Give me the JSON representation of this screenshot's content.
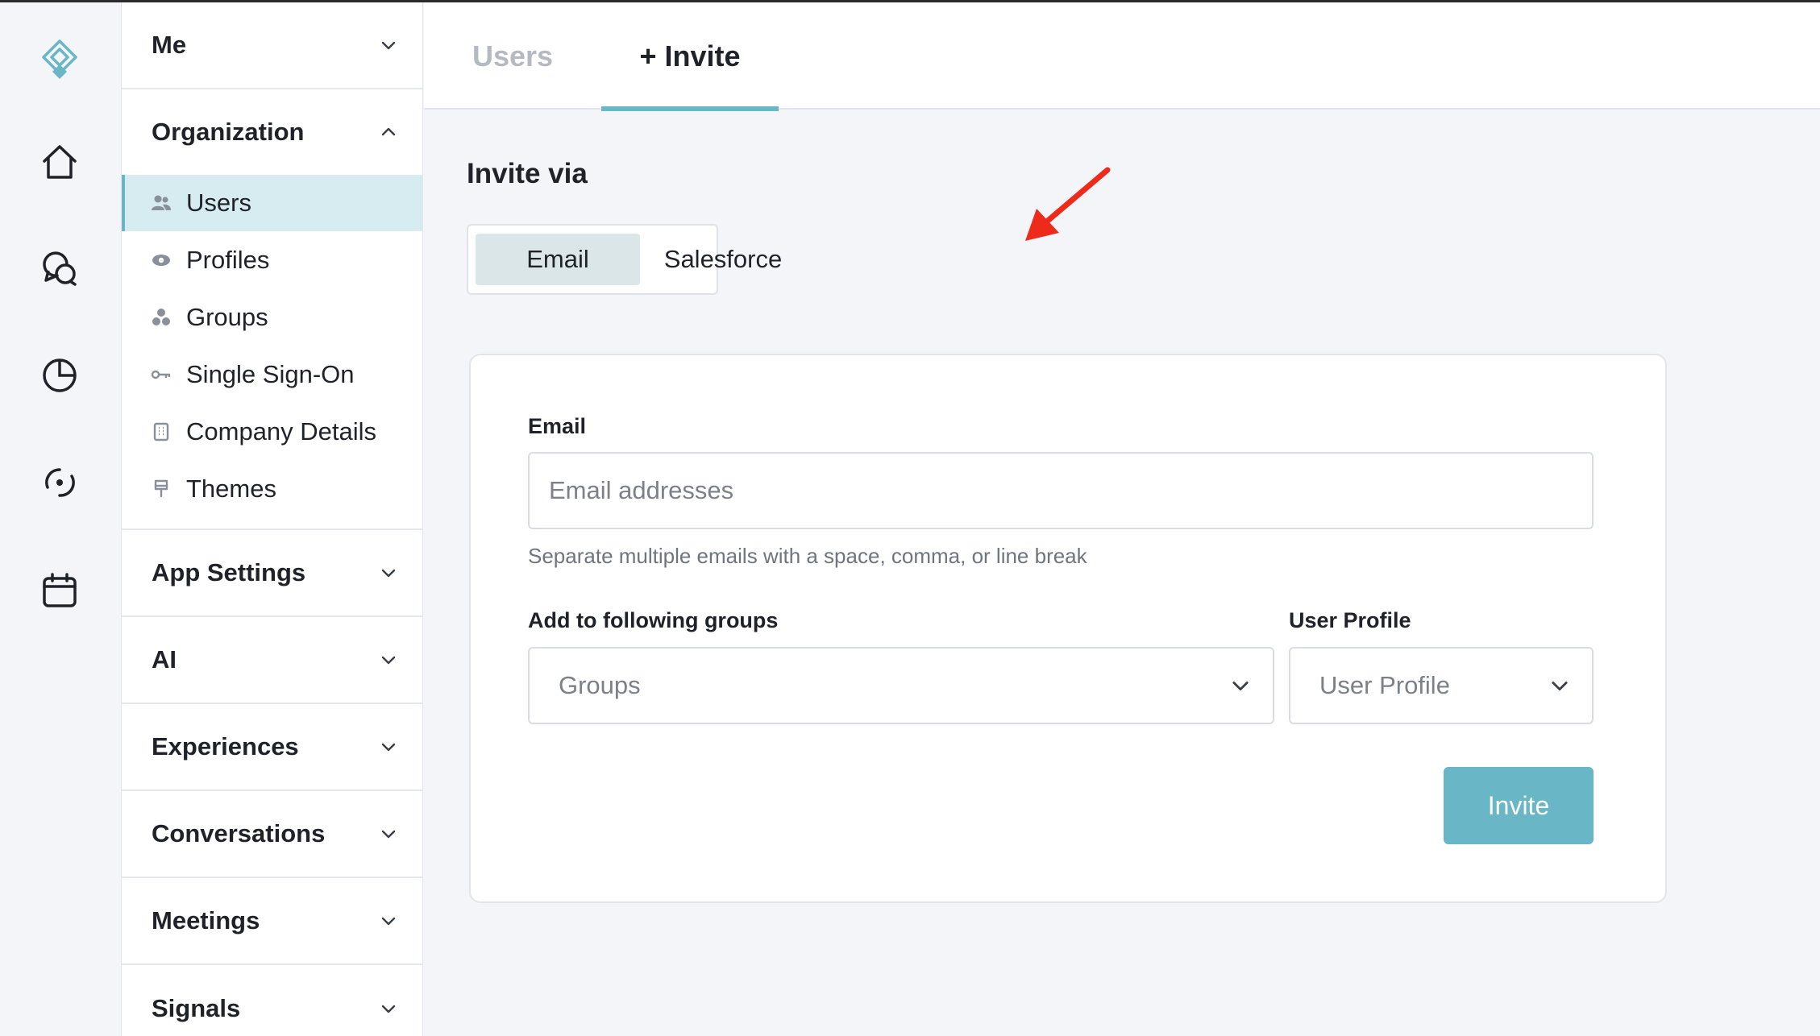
{
  "sidebar": {
    "me": "Me",
    "organization": {
      "label": "Organization",
      "items": [
        {
          "label": "Users",
          "icon": "users-icon",
          "active": true
        },
        {
          "label": "Profiles",
          "icon": "eye-icon"
        },
        {
          "label": "Groups",
          "icon": "groups-icon"
        },
        {
          "label": "Single Sign-On",
          "icon": "key-icon"
        },
        {
          "label": "Company Details",
          "icon": "building-icon"
        },
        {
          "label": "Themes",
          "icon": "paintbrush-icon"
        }
      ]
    },
    "sections": [
      "App Settings",
      "AI",
      "Experiences",
      "Conversations",
      "Meetings",
      "Signals"
    ]
  },
  "rail": {
    "icons": [
      "logo-icon",
      "home-icon",
      "chat-icon",
      "pie-chart-icon",
      "signal-icon",
      "calendar-icon"
    ]
  },
  "tabs": {
    "users": "Users",
    "invite": "+ Invite"
  },
  "invite": {
    "heading": "Invite via",
    "methods": {
      "email": "Email",
      "salesforce": "Salesforce"
    },
    "selected_method": "Email"
  },
  "form": {
    "email_label": "Email",
    "email_placeholder": "Email addresses",
    "email_help": "Separate multiple emails with a space, comma, or line break",
    "groups_label": "Add to following groups",
    "groups_placeholder": "Groups",
    "profile_label": "User Profile",
    "profile_placeholder": "User Profile",
    "submit": "Invite"
  },
  "colors": {
    "accent": "#69b6c7",
    "active_nav_bg": "#d7ecf0",
    "arrow": "#ee2a1b"
  }
}
